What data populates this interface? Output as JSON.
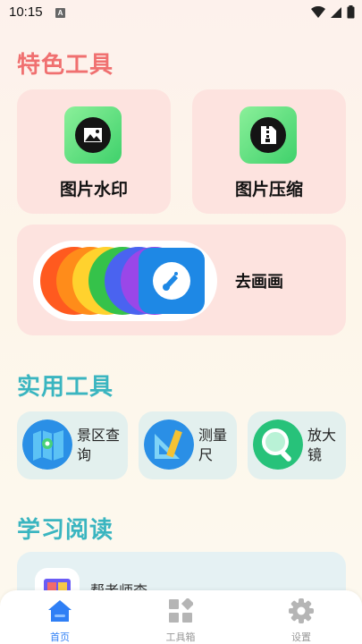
{
  "status_bar": {
    "time": "10:15",
    "notification_letter": "A"
  },
  "sections": {
    "featured": "特色工具",
    "practical": "实用工具",
    "study": "学习阅读"
  },
  "featured_tools": {
    "watermark": "图片水印",
    "compress": "图片压缩",
    "draw": "去画画"
  },
  "practical_tools": [
    {
      "label_line1": "景区查",
      "label_line2": "询"
    },
    {
      "label_line1": "测量",
      "label_line2": "尺"
    },
    {
      "label_line1": "放大",
      "label_line2": "镜"
    }
  ],
  "study_items": [
    {
      "label": "帮老师查"
    }
  ],
  "tab_bar": {
    "home": "首页",
    "toolbox": "工具箱",
    "settings": "设置"
  },
  "colors": {
    "accent": "#2f7ff5",
    "featured_title": "#f07070",
    "section_title": "#3ab5c0",
    "card_pink": "#fde3df",
    "card_mint": "#e3f0ee"
  },
  "icons": {
    "watermark": "image-icon",
    "compress": "zip-file-icon",
    "draw": "palette-icon",
    "scenic": "map-icon",
    "ruler": "ruler-icon",
    "magnifier": "magnifier-icon",
    "home": "home-icon",
    "toolbox": "toolbox-icon",
    "settings": "gear-icon"
  }
}
